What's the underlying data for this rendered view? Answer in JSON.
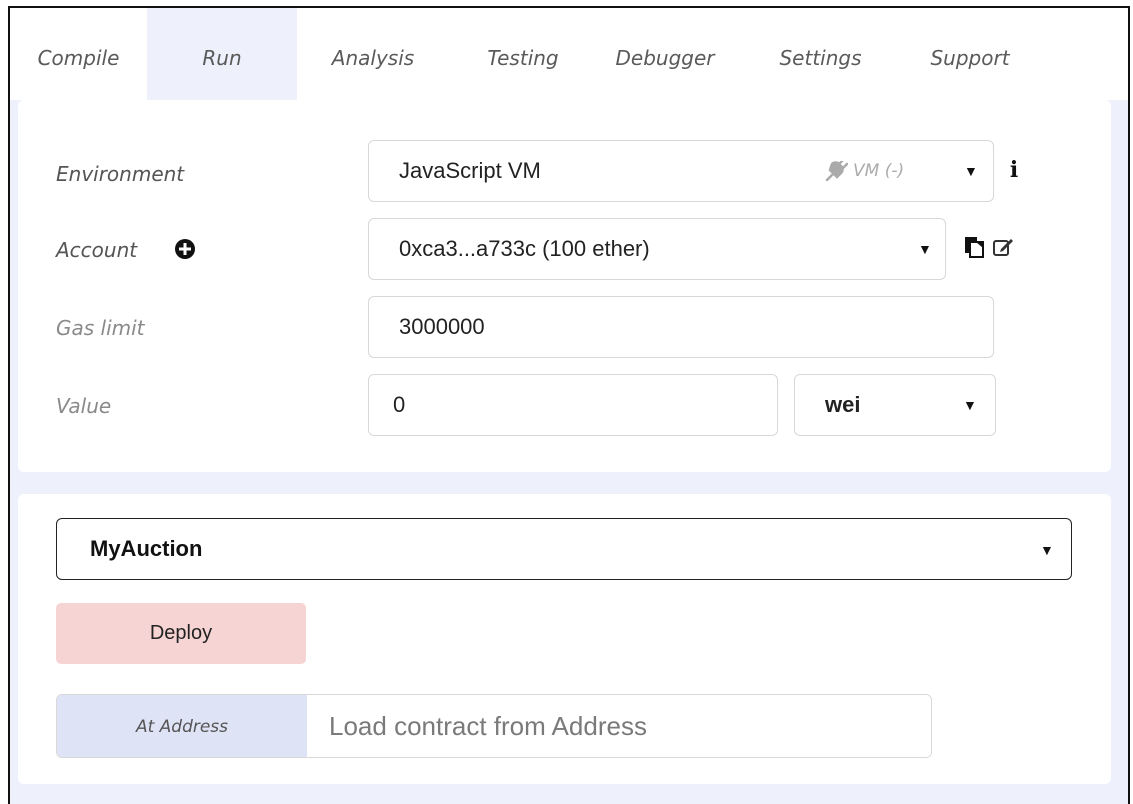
{
  "tabs": [
    {
      "label": "Compile"
    },
    {
      "label": "Run"
    },
    {
      "label": "Analysis"
    },
    {
      "label": "Testing"
    },
    {
      "label": "Debugger"
    },
    {
      "label": "Settings"
    },
    {
      "label": "Support"
    }
  ],
  "active_tab": "Run",
  "env": {
    "label": "Environment",
    "value": "JavaScript VM",
    "vm_status": "VM (-)"
  },
  "account": {
    "label": "Account",
    "value": "0xca3...a733c (100 ether)"
  },
  "gas": {
    "label": "Gas limit",
    "value": "3000000"
  },
  "value": {
    "label": "Value",
    "amount": "0",
    "unit": "wei"
  },
  "contract": {
    "selected": "MyAuction"
  },
  "deploy": {
    "label": "Deploy"
  },
  "at_address": {
    "label": "At Address",
    "placeholder": "Load contract from Address"
  },
  "colors": {
    "deploy_bg": "#f6d4d4",
    "at_address_bg": "#dfe3f6",
    "panel_bg": "#eef0fb"
  }
}
